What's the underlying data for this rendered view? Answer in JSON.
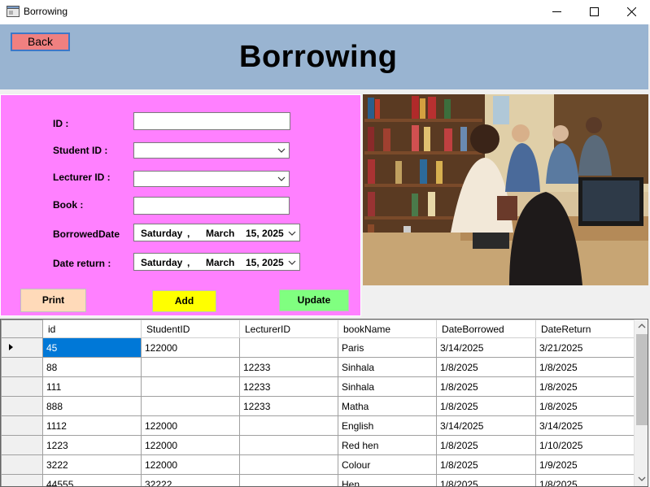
{
  "window": {
    "title": "Borrowing",
    "icon": "app-window-icon"
  },
  "header": {
    "back_label": "Back",
    "page_title": "Borrowing",
    "background": "#99b4d1"
  },
  "form": {
    "id_label": "ID :",
    "student_label": "Student ID :",
    "lecturer_label": "Lecturer ID :",
    "book_label": "Book :",
    "borrowed_label": "BorrowedDate",
    "return_label": "Date return :",
    "id_value": "",
    "student_value": "",
    "lecturer_value": "",
    "book_value": "",
    "borrowed_date": {
      "day": "Saturday",
      "sep": ",",
      "month": "March",
      "date": "15, 2025"
    },
    "return_date": {
      "day": "Saturday",
      "sep": ",",
      "month": "March",
      "date": "15, 2025"
    },
    "background": "#ff80ff"
  },
  "actions": {
    "print_label": "Print",
    "add_label": "Add",
    "update_label": "Update",
    "print_color": "#ffdab9",
    "add_color": "#ffff00",
    "update_color": "#80ff80"
  },
  "photo": {
    "icon": "library-photo"
  },
  "grid": {
    "columns": [
      "id",
      "StudentID",
      "LecturerID",
      "bookName",
      "DateBorrowed",
      "DateReturn"
    ],
    "rows": [
      [
        "45",
        "122000",
        "",
        "Paris",
        "3/14/2025",
        "3/21/2025"
      ],
      [
        "88",
        "",
        "12233",
        "Sinhala",
        "1/8/2025",
        "1/8/2025"
      ],
      [
        "111",
        "",
        "12233",
        "Sinhala",
        "1/8/2025",
        "1/8/2025"
      ],
      [
        "888",
        "",
        "12233",
        "Matha",
        "1/8/2025",
        "1/8/2025"
      ],
      [
        "1112",
        "122000",
        "",
        "English",
        "3/14/2025",
        "3/14/2025"
      ],
      [
        "1223",
        "122000",
        "",
        "Red hen",
        "1/8/2025",
        "1/10/2025"
      ],
      [
        "3222",
        "122000",
        "",
        "Colour",
        "1/8/2025",
        "1/9/2025"
      ],
      [
        "44555",
        "32222",
        "",
        "Hen",
        "1/8/2025",
        "1/8/2025"
      ]
    ],
    "selected_row": 0,
    "selection_color": "#0078d7"
  }
}
